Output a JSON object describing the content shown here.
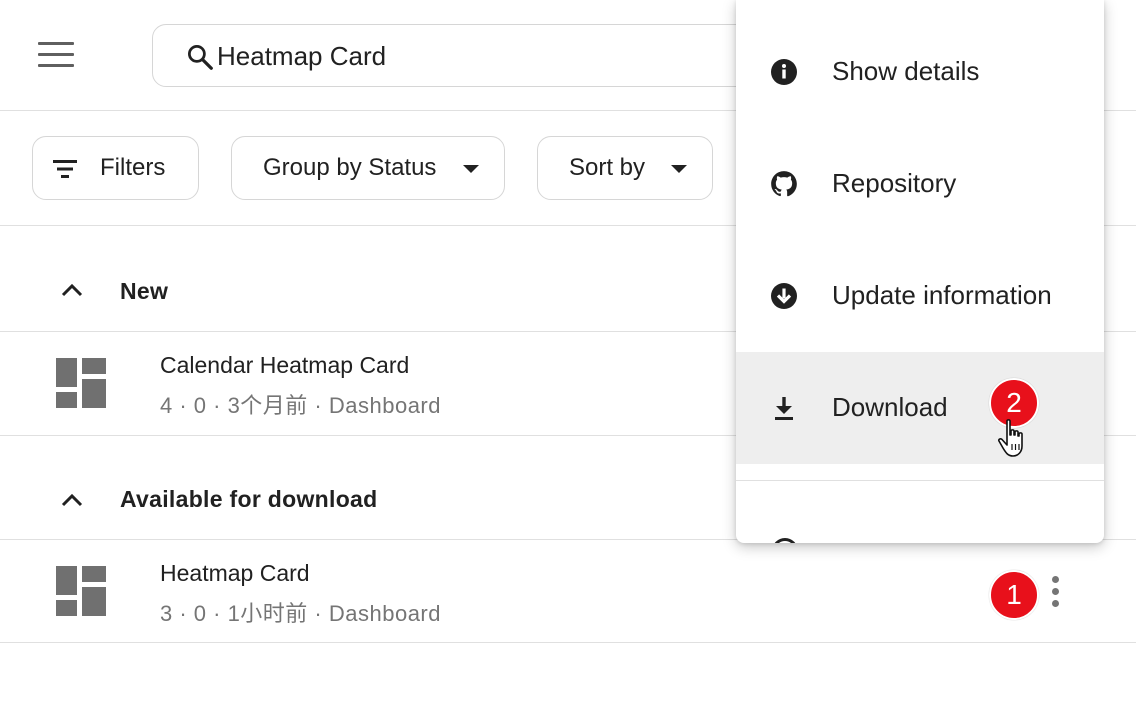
{
  "header": {
    "menu_icon": "hamburger-menu-icon",
    "search": {
      "value": "Heatmap Card",
      "icon": "search-icon"
    }
  },
  "toolbar": {
    "filters_label": "Filters",
    "group_label": "Group by Status",
    "sort_label": "Sort by"
  },
  "sections": [
    {
      "title": "New",
      "items": [
        {
          "title": "Calendar Heatmap Card",
          "subtitle": "4 · 0 · 3个月前 · Dashboard",
          "icon": "dashboard-icon"
        }
      ]
    },
    {
      "title": "Available for download",
      "items": [
        {
          "title": "Heatmap Card",
          "subtitle": "3 · 0 · 1小时前 · Dashboard",
          "icon": "dashboard-icon"
        }
      ]
    }
  ],
  "context_menu": {
    "items": [
      {
        "label": "Show details",
        "icon": "info-icon"
      },
      {
        "label": "Repository",
        "icon": "github-icon"
      },
      {
        "label": "Update information",
        "icon": "arrow-down-circle-icon"
      },
      {
        "label": "Download",
        "icon": "download-icon",
        "highlighted": true
      }
    ]
  },
  "annotations": {
    "badge_1": "1",
    "badge_2": "2",
    "badge_color": "#e8101b"
  }
}
